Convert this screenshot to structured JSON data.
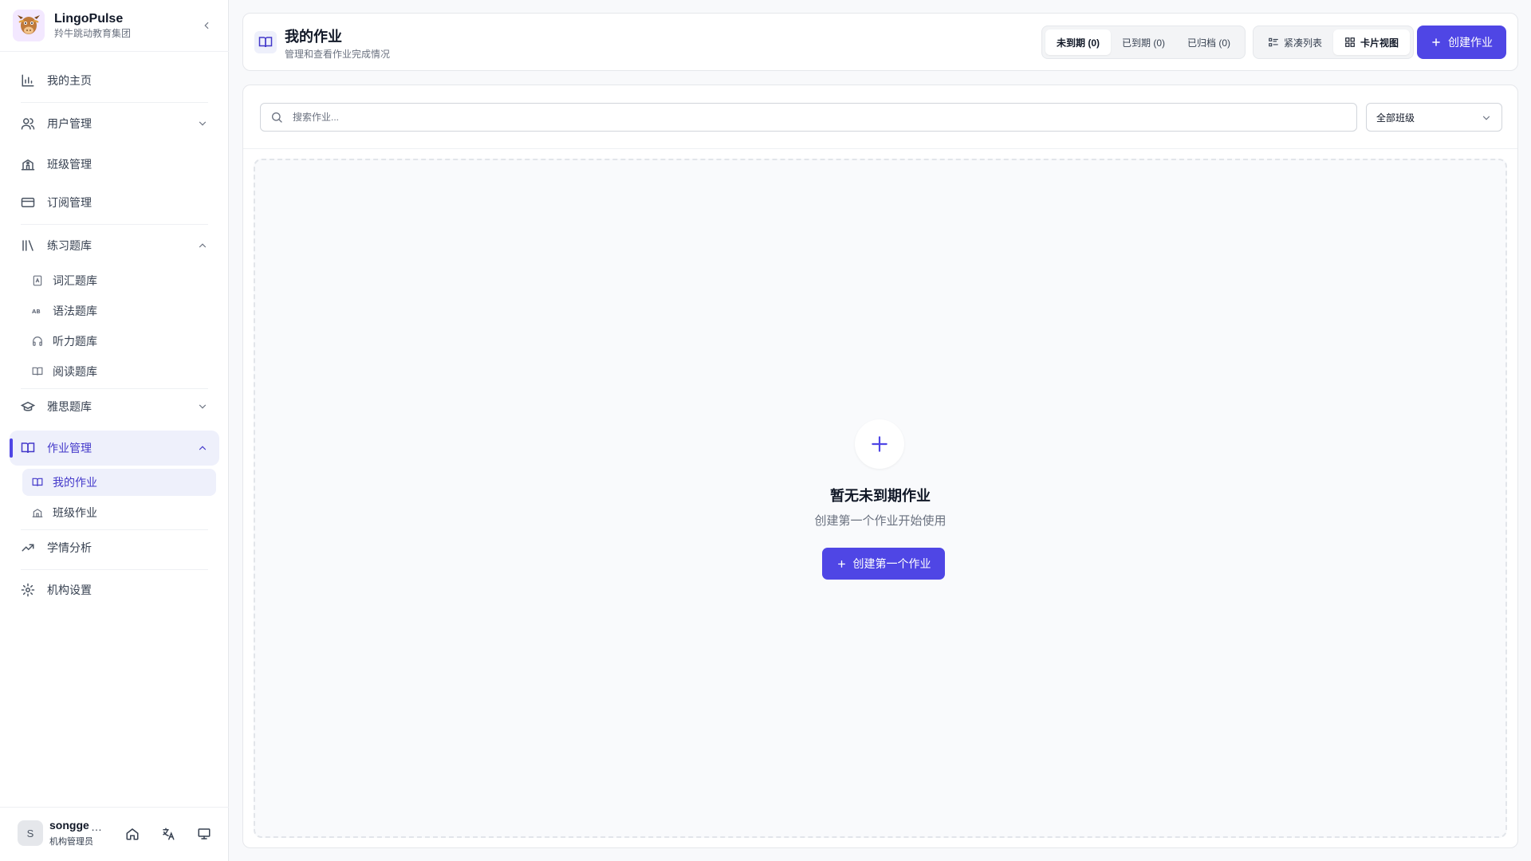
{
  "brand": {
    "name": "LingoPulse",
    "org": "羚牛跳动教育集团"
  },
  "sidebar": {
    "home": "我的主页",
    "users": "用户管理",
    "classes": "班级管理",
    "subscriptions": "订阅管理",
    "practice": {
      "label": "练习题库",
      "items": [
        "词汇题库",
        "语法题库",
        "听力题库",
        "阅读题库"
      ]
    },
    "ielts": "雅思题库",
    "homework": {
      "label": "作业管理",
      "items": [
        "我的作业",
        "班级作业"
      ]
    },
    "analytics": "学情分析",
    "settings": "机构设置"
  },
  "user": {
    "initial": "S",
    "name": "songge",
    "role": "机构管理员",
    "more": "…"
  },
  "header": {
    "title": "我的作业",
    "subtitle": "管理和查看作业完成情况",
    "tabs": [
      "未到期 (0)",
      "已到期 (0)",
      "已归档 (0)"
    ],
    "views": [
      "紧凑列表",
      "卡片视图"
    ],
    "create_label": "创建作业"
  },
  "filters": {
    "search_placeholder": "搜索作业...",
    "class_select": "全部班级"
  },
  "empty": {
    "title": "暂无未到期作业",
    "description": "创建第一个作业开始使用",
    "button": "创建第一个作业"
  },
  "colors": {
    "accent": "#4f46e5",
    "active_bg": "#eef0fb"
  }
}
